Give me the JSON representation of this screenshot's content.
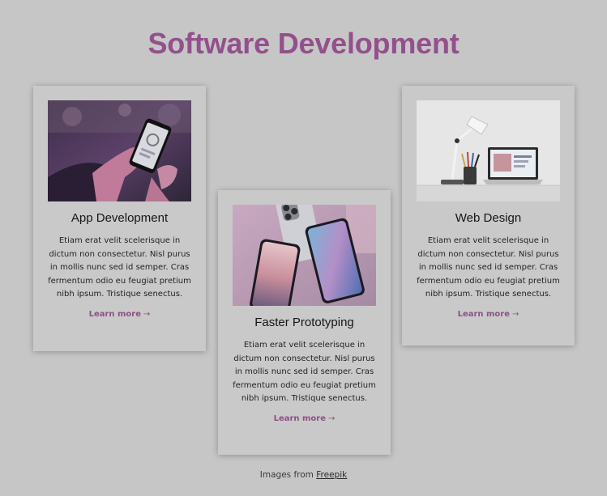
{
  "page": {
    "title": "Software Development",
    "title_color": "#93508c",
    "background": "#c6c6c6"
  },
  "cards": [
    {
      "title": "App Development",
      "text": "Etiam erat velit scelerisque in dictum non consectetur. Nisl purus in mollis nunc sed id semper. Cras fermentum odio eu feugiat pretium nibh ipsum. Tristique senectus.",
      "link_label": "Learn more",
      "arrow": "→",
      "image": "hands-holding-smartphone"
    },
    {
      "title": "Faster Prototyping",
      "text": "Etiam erat velit scelerisque in dictum non consectetur. Nisl purus in mollis nunc sed id semper. Cras fermentum odio eu feugiat pretium nibh ipsum. Tristique senectus.",
      "link_label": "Learn more",
      "arrow": "→",
      "image": "two-phones-mockup"
    },
    {
      "title": "Web Design",
      "text": "Etiam erat velit scelerisque in dictum non consectetur. Nisl purus in mollis nunc sed id semper. Cras fermentum odio eu feugiat pretium nibh ipsum. Tristique senectus.",
      "link_label": "Learn more",
      "arrow": "→",
      "image": "desk-lamp-laptop"
    }
  ],
  "footer": {
    "prefix": "Images from",
    "link_label": "Freepik"
  }
}
